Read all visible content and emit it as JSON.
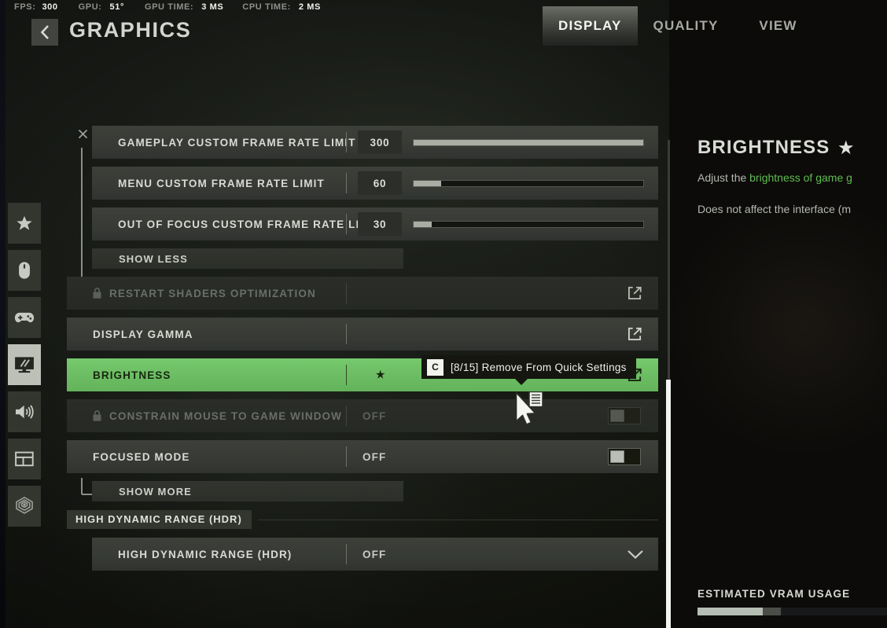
{
  "perf_overlay": [
    {
      "key": "FPS:",
      "value": "300"
    },
    {
      "key": "GPU:",
      "value": "51°"
    },
    {
      "key": "GPU TIME:",
      "value": "3 MS"
    },
    {
      "key": "CPU TIME:",
      "value": "2 MS"
    }
  ],
  "header": {
    "title": "GRAPHICS",
    "back_icon": "chevron-left-icon"
  },
  "tabs": [
    {
      "label": "DISPLAY",
      "active": true
    },
    {
      "label": "QUALITY",
      "active": false
    },
    {
      "label": "VIEW",
      "active": false
    }
  ],
  "rail": [
    {
      "name": "favorites",
      "icon": "star-icon",
      "active": false
    },
    {
      "name": "mouse-keyboard",
      "icon": "mouse-icon",
      "active": false
    },
    {
      "name": "controller",
      "icon": "gamepad-icon",
      "active": false
    },
    {
      "name": "graphics",
      "icon": "monitor-icon",
      "active": true
    },
    {
      "name": "audio",
      "icon": "speaker-icon",
      "active": false
    },
    {
      "name": "interface",
      "icon": "hud-panel-icon",
      "active": false
    },
    {
      "name": "accessibility",
      "icon": "radar-icon",
      "active": false
    }
  ],
  "settings": {
    "group_expanded_toggle": "SHOW LESS",
    "show_more": "SHOW MORE",
    "rows": [
      {
        "name": "gameplay-custom-frame-rate-limit",
        "label": "GAMEPLAY CUSTOM FRAME RATE LIMIT",
        "value": "300",
        "fill_percent": 100,
        "control": "slider"
      },
      {
        "name": "menu-custom-frame-rate-limit",
        "label": "MENU CUSTOM FRAME RATE LIMIT",
        "value": "60",
        "fill_percent": 12,
        "control": "slider"
      },
      {
        "name": "out-of-focus-custom-frame-rate-limit",
        "label": "OUT OF FOCUS CUSTOM FRAME RATE LIMIT",
        "value": "30",
        "fill_percent": 8,
        "control": "slider"
      }
    ],
    "restart_shaders": {
      "label": "RESTART SHADERS OPTIMIZATION",
      "locked": true,
      "icon": "external-link-icon"
    },
    "display_gamma": {
      "label": "DISPLAY GAMMA",
      "icon": "external-link-icon"
    },
    "brightness": {
      "label": "BRIGHTNESS",
      "favorited": true,
      "star": "★",
      "icon": "external-link-icon",
      "highlighted": true
    },
    "constrain_mouse": {
      "label": "CONSTRAIN MOUSE TO GAME WINDOW",
      "value": "OFF",
      "locked": true,
      "control": "toggle"
    },
    "focused_mode": {
      "label": "FOCUSED MODE",
      "value": "OFF",
      "control": "toggle"
    },
    "hdr_section_header": "HIGH DYNAMIC RANGE (HDR)",
    "hdr_row": {
      "label": "HIGH DYNAMIC RANGE (HDR)",
      "value": "OFF",
      "control": "dropdown",
      "icon": "chevron-down-icon"
    }
  },
  "tooltip": {
    "key": "C",
    "text": "[8/15] Remove From Quick Settings"
  },
  "info_panel": {
    "title": "BRIGHTNESS",
    "star": "★",
    "line1_prefix": "Adjust the ",
    "line1_highlight": "brightness of game g",
    "line2": "Does not affect the interface (m",
    "vram_label": "ESTIMATED VRAM USAGE",
    "vram_fill_percent": 26,
    "vram_secondary_percent": 7
  },
  "colors": {
    "accent_green": "#6cbc63",
    "highlight_text_green": "#5fbc52",
    "panel": "#383b35",
    "background": "#1d201b"
  }
}
